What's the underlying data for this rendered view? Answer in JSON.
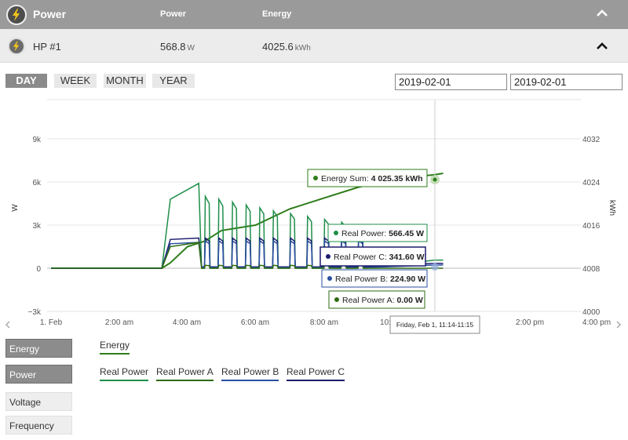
{
  "header": {
    "title": "Power",
    "col_power": "Power",
    "col_energy": "Energy",
    "icon": "lightning-icon"
  },
  "device": {
    "name": "HP #1",
    "power_value": "568.8",
    "power_unit": "W",
    "energy_value": "4025.6",
    "energy_unit": "kWh"
  },
  "range_tabs": [
    "DAY",
    "WEEK",
    "MONTH",
    "YEAR"
  ],
  "active_tab": "DAY",
  "dates": {
    "from": "2019-02-01",
    "to": "2019-02-01"
  },
  "chart": {
    "left_axis_label": "W",
    "right_axis_label": "kWh",
    "left_ticks": [
      "9k",
      "6k",
      "3k",
      "0",
      "−3k"
    ],
    "right_ticks": [
      "4032",
      "4024",
      "4016",
      "4008",
      "4000"
    ],
    "x_ticks": [
      "1. Feb",
      "2:00 am",
      "4:00 am",
      "6:00 am",
      "8:00 am",
      "10:",
      "2:00 pm",
      "4:00 pm"
    ],
    "tooltip_time": "Friday, Feb 1, 11:14-11:15",
    "tooltips": {
      "energy_sum_label": "Energy Sum:",
      "energy_sum_value": "4 025.35 kWh",
      "real_power_label": "Real Power:",
      "real_power_value": "566.45 W",
      "real_power_c_label": "Real Power C:",
      "real_power_c_value": "341.60 W",
      "real_power_b_label": "Real Power B:",
      "real_power_b_value": "224.90 W",
      "real_power_a_label": "Real Power A:",
      "real_power_a_value": "0.00 W"
    },
    "colors": {
      "energy": "#2e7d1a",
      "real_power": "#1f8f4a",
      "real_power_a": "#2d6b10",
      "real_power_b": "#2a4fa0",
      "real_power_c": "#1c1c6e",
      "grid": "#e6e6e6",
      "crosshair": "#cccccc"
    }
  },
  "chart_data": {
    "type": "line",
    "x_unit": "time of day",
    "x": [
      "00:00",
      "03:15",
      "03:30",
      "04:00",
      "04:30",
      "05:00",
      "06:00",
      "07:00",
      "08:00",
      "09:00",
      "10:00",
      "11:15",
      "11:30"
    ],
    "series": [
      {
        "name": "Energy",
        "axis": "right",
        "values": [
          4008,
          4008,
          4009,
          4012,
          4013,
          4015,
          4016,
          4019,
          4021,
          4023,
          4024.5,
          4025.35,
          4025.6
        ]
      },
      {
        "name": "Real Power",
        "axis": "left",
        "values": [
          0,
          0,
          4800,
          5900,
          2000,
          2000,
          800,
          700,
          600,
          500,
          500,
          566.45,
          568
        ]
      },
      {
        "name": "Real Power A",
        "axis": "left",
        "values": [
          0,
          0,
          1500,
          1800,
          0,
          0,
          0,
          0,
          0,
          0,
          0,
          0,
          0
        ]
      },
      {
        "name": "Real Power B",
        "axis": "left",
        "values": [
          0,
          0,
          1700,
          1800,
          1800,
          1900,
          1900,
          1900,
          1900,
          250,
          250,
          224.9,
          225
        ]
      },
      {
        "name": "Real Power C",
        "axis": "left",
        "values": [
          0,
          0,
          2000,
          2100,
          2100,
          2100,
          2100,
          2100,
          2000,
          340,
          340,
          341.6,
          342
        ]
      }
    ],
    "ylim_left": [
      -3000,
      9000
    ],
    "ylim_right": [
      4000,
      4032
    ]
  },
  "legend": {
    "toggles": [
      {
        "label": "Energy",
        "on": true
      },
      {
        "label": "Power",
        "on": true
      },
      {
        "label": "Voltage",
        "on": false
      },
      {
        "label": "Frequency",
        "on": false
      }
    ],
    "energy_series": [
      "Energy"
    ],
    "power_series": [
      "Real Power",
      "Real Power A",
      "Real Power B",
      "Real Power C"
    ]
  }
}
